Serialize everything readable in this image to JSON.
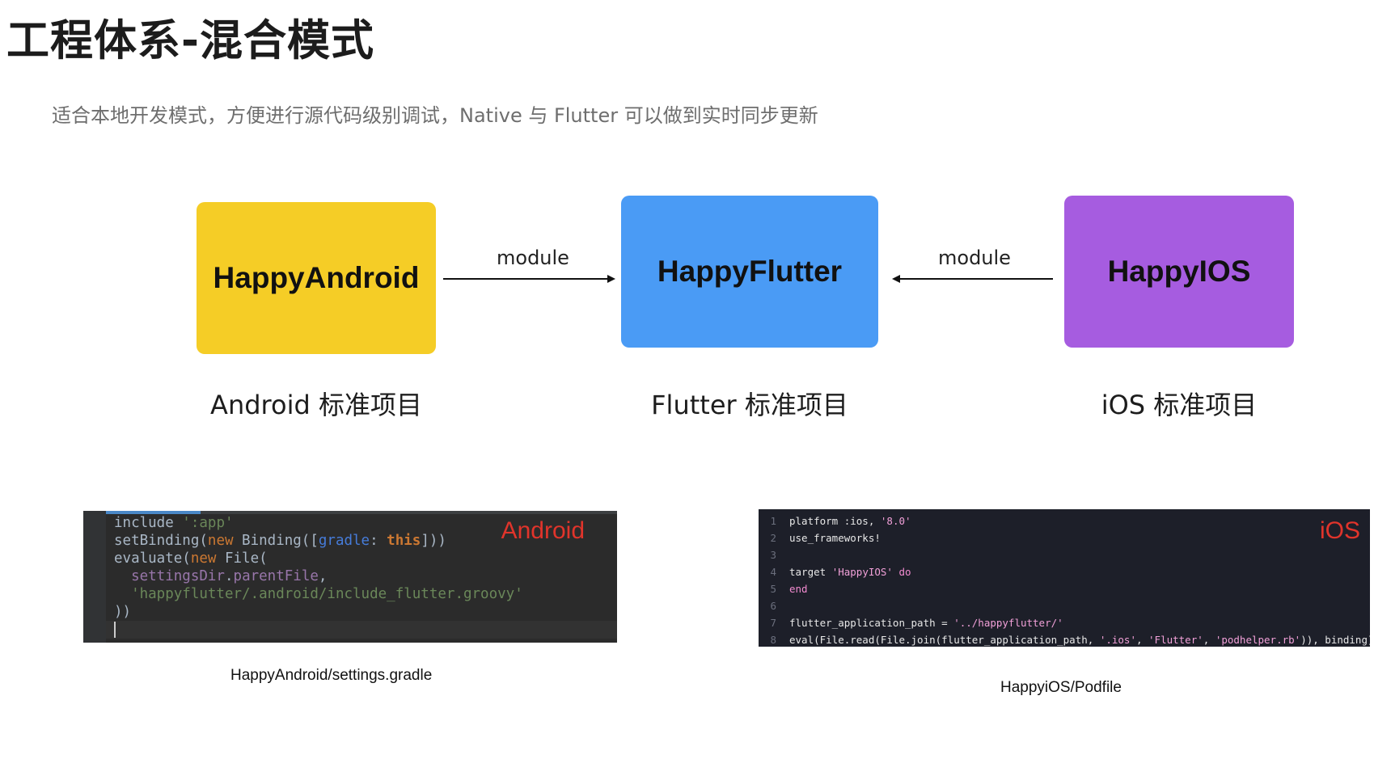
{
  "title": "工程体系-混合模式",
  "subtitle": "适合本地开发模式，方便进行源代码级别调试，Native 与 Flutter 可以做到实时同步更新",
  "diagram": {
    "boxes": [
      {
        "label": "HappyAndroid",
        "color": "#f5cd26",
        "caption": "Android 标准项目"
      },
      {
        "label": "HappyFlutter",
        "color": "#4a9bf5",
        "caption": "Flutter 标准项目"
      },
      {
        "label": "HappyIOS",
        "color": "#a65ce0",
        "caption": "iOS 标准项目"
      }
    ],
    "arrows": [
      {
        "label": "module",
        "from": "HappyAndroid",
        "to": "HappyFlutter"
      },
      {
        "label": "module",
        "from": "HappyIOS",
        "to": "HappyFlutter"
      }
    ]
  },
  "code_android": {
    "tag": "Android",
    "file": "HappyAndroid/settings.gradle",
    "lines": [
      "include ':app'",
      "setBinding(new Binding([gradle: this]))",
      "evaluate(new File(",
      "  settingsDir.parentFile,",
      "  'happyflutter/.android/include_flutter.groovy'",
      "))"
    ]
  },
  "code_ios": {
    "tag": "iOS",
    "file": "HappyiOS/Podfile",
    "lines": [
      {
        "n": "1",
        "text": "platform :ios, '8.0'"
      },
      {
        "n": "2",
        "text": "use_frameworks!"
      },
      {
        "n": "3",
        "text": ""
      },
      {
        "n": "4",
        "text": "target 'HappyIOS' do"
      },
      {
        "n": "5",
        "text": "end"
      },
      {
        "n": "6",
        "text": ""
      },
      {
        "n": "7",
        "text": "flutter_application_path = '../happyflutter/'"
      },
      {
        "n": "8",
        "text": "eval(File.read(File.join(flutter_application_path, '.ios', 'Flutter', 'podhelper.rb')), binding)"
      }
    ]
  }
}
